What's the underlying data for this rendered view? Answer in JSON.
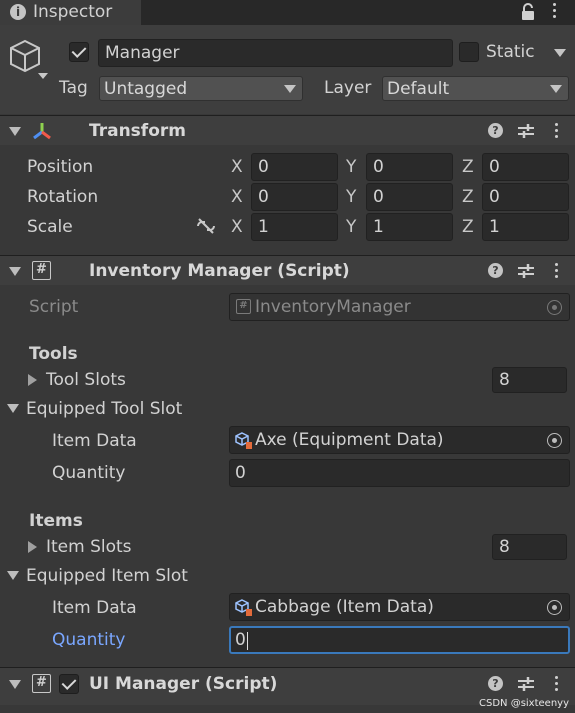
{
  "tab": {
    "title": "Inspector"
  },
  "header": {
    "object_name": "Manager",
    "static_label": "Static",
    "tag_label": "Tag",
    "tag_value": "Untagged",
    "layer_label": "Layer",
    "layer_value": "Default"
  },
  "transform": {
    "title": "Transform",
    "rows": [
      {
        "label": "Position",
        "x": "0",
        "y": "0",
        "z": "0"
      },
      {
        "label": "Rotation",
        "x": "0",
        "y": "0",
        "z": "0"
      },
      {
        "label": "Scale",
        "x": "1",
        "y": "1",
        "z": "1"
      }
    ],
    "axis_x": "X",
    "axis_y": "Y",
    "axis_z": "Z"
  },
  "inventory": {
    "title": "Inventory Manager (Script)",
    "script_label": "Script",
    "script_value": "InventoryManager",
    "tools_header": "Tools",
    "tool_slots_label": "Tool Slots",
    "tool_slots_value": "8",
    "equipped_tool_label": "Equipped Tool Slot",
    "tool_item_data_label": "Item Data",
    "tool_item_data_value": "Axe (Equipment Data)",
    "tool_quantity_label": "Quantity",
    "tool_quantity_value": "0",
    "items_header": "Items",
    "item_slots_label": "Item Slots",
    "item_slots_value": "8",
    "equipped_item_label": "Equipped Item Slot",
    "item_item_data_label": "Item Data",
    "item_item_data_value": "Cabbage (Item Data)",
    "item_quantity_label": "Quantity",
    "item_quantity_value": "0"
  },
  "ui_manager": {
    "title": "UI Manager (Script)"
  },
  "watermark": "CSDN @sixteenyy",
  "colors": {
    "background": "#383838",
    "field": "#2a2a2a",
    "focus": "#3a79bb",
    "accent_blue": "#7aa7ff"
  }
}
